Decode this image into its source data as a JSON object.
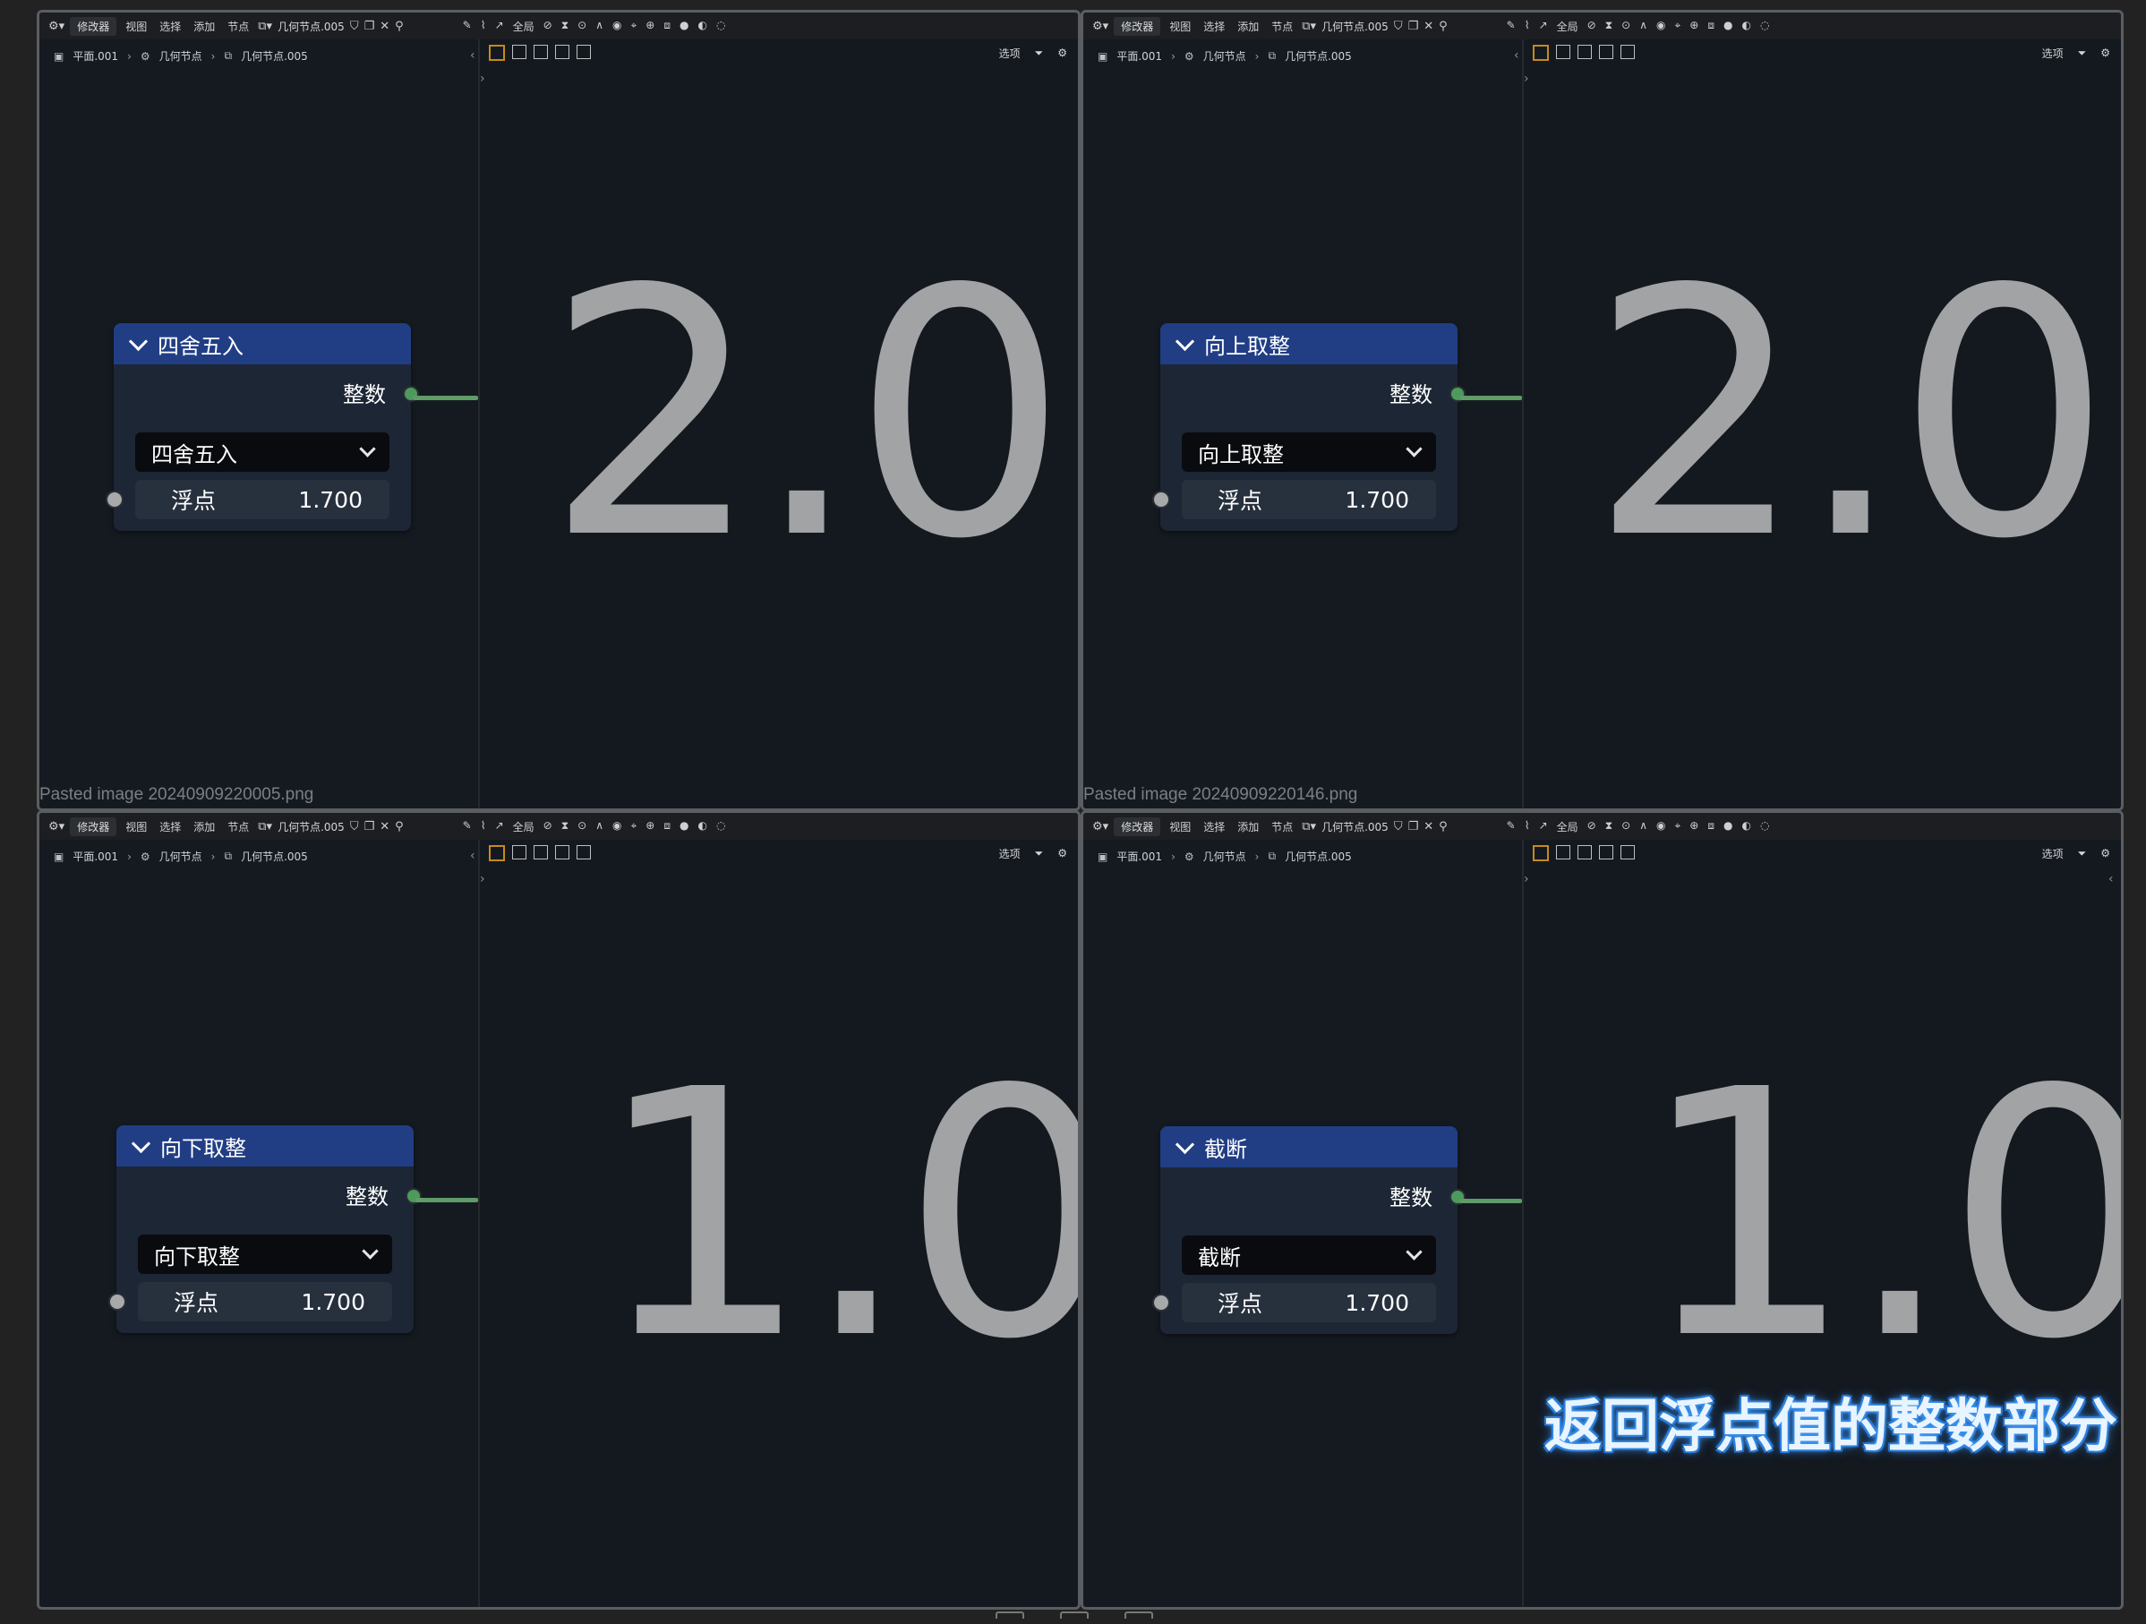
{
  "toolbar": {
    "editor_type_dropdown": "修改器",
    "menus": [
      "视图",
      "选择",
      "添加",
      "节点"
    ],
    "nodegroup_name": "几何节点.005",
    "global_dropdown": "全局",
    "options_label": "选项"
  },
  "breadcrumb": {
    "object": "平面.001",
    "modifier": "几何节点",
    "nodegroup": "几何节点.005"
  },
  "node_common": {
    "output_label": "整数",
    "input_label": "浮点",
    "input_value": "1.700"
  },
  "panels": [
    {
      "title": "四舍五入",
      "mode": "四舍五入",
      "result": "2.0",
      "caption": "Pasted image 20240909220005.png"
    },
    {
      "title": "向上取整",
      "mode": "向上取整",
      "result": "2.0",
      "caption": "Pasted image 20240909220146.png"
    },
    {
      "title": "向下取整",
      "mode": "向下取整",
      "result": "1.0",
      "caption": ""
    },
    {
      "title": "截断",
      "mode": "截断",
      "result": "1.0",
      "caption": ""
    }
  ],
  "subtitle": "返回浮点值的整数部分",
  "colors": {
    "node_header": "#213e85",
    "node_body": "#1d2634",
    "socket_output": "#4c9a5c",
    "socket_input": "#a7a9ab",
    "result_text": "#a2a3a5"
  }
}
